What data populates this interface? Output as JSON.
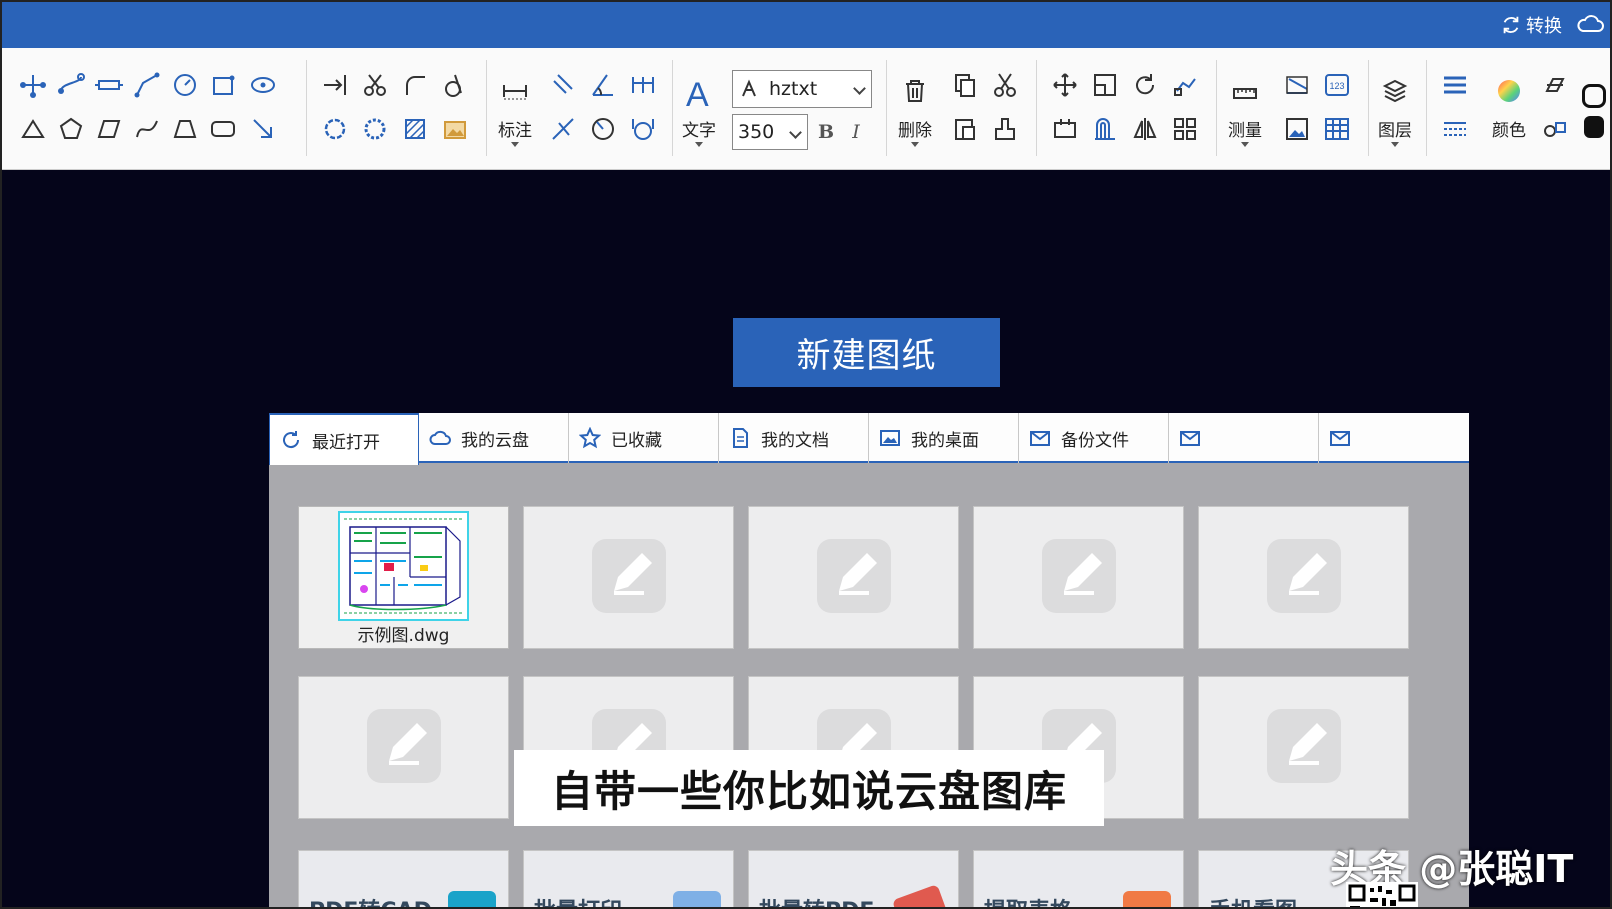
{
  "titlebar": {
    "convert_label": "转换"
  },
  "ribbon": {
    "annotate_label": "标注",
    "text_label": "文字",
    "font_name": "hztxt",
    "font_size": "350",
    "bold_label": "B",
    "italic_label": "I",
    "delete_label": "删除",
    "measure_label": "测量",
    "layer_label": "图层",
    "color_label": "颜色"
  },
  "new_drawing_label": "新建图纸",
  "tabs": [
    {
      "label": "最近打开",
      "icon": "refresh-icon"
    },
    {
      "label": "我的云盘",
      "icon": "cloud-icon"
    },
    {
      "label": "已收藏",
      "icon": "star-icon"
    },
    {
      "label": "我的文档",
      "icon": "document-icon"
    },
    {
      "label": "我的桌面",
      "icon": "picture-icon"
    },
    {
      "label": "备份文件",
      "icon": "mail-icon"
    },
    {
      "label": "",
      "icon": "mail-icon"
    },
    {
      "label": "",
      "icon": "mail-icon"
    }
  ],
  "recent_files": [
    {
      "name": "示例图.dwg"
    }
  ],
  "bottom_cards": [
    "PDF转CAD",
    "批量打印",
    "批量转PDF",
    "提取表格",
    "手机看图"
  ],
  "subtitle": "自带一些你比如说云盘图库",
  "watermark": "头条 @张聪IT",
  "colors": {
    "accent": "#2a63b8",
    "background": "#05051a",
    "panel": "#a9a9ad"
  }
}
